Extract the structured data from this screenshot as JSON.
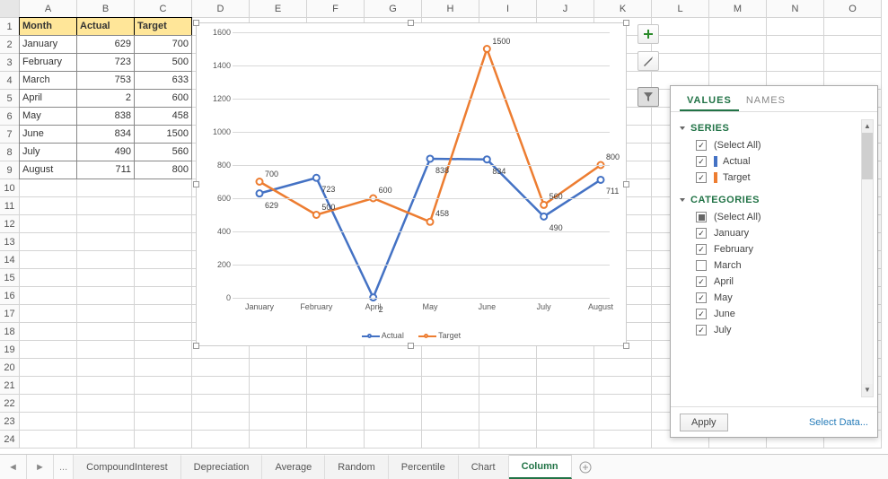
{
  "columns": [
    "A",
    "B",
    "C",
    "D",
    "E",
    "F",
    "G",
    "H",
    "I",
    "J",
    "K",
    "L",
    "M",
    "N",
    "O"
  ],
  "rows": [
    "1",
    "2",
    "3",
    "4",
    "5",
    "6",
    "7",
    "8",
    "9",
    "10",
    "11",
    "12",
    "13",
    "14",
    "15",
    "16",
    "17",
    "18",
    "19",
    "20",
    "21",
    "22",
    "23",
    "24"
  ],
  "table": {
    "headers": [
      "Month",
      "Actual",
      "Target"
    ],
    "data": [
      [
        "January",
        "629",
        "700"
      ],
      [
        "February",
        "723",
        "500"
      ],
      [
        "March",
        "753",
        "633"
      ],
      [
        "April",
        "2",
        "600"
      ],
      [
        "May",
        "838",
        "458"
      ],
      [
        "June",
        "834",
        "1500"
      ],
      [
        "July",
        "490",
        "560"
      ],
      [
        "August",
        "711",
        "800"
      ]
    ]
  },
  "chart_data": {
    "type": "line",
    "categories": [
      "January",
      "February",
      "April",
      "May",
      "June",
      "July",
      "August"
    ],
    "series": [
      {
        "name": "Actual",
        "color": "#4472C4",
        "values": [
          629,
          723,
          2,
          838,
          834,
          490,
          711
        ]
      },
      {
        "name": "Target",
        "color": "#ED7D31",
        "values": [
          700,
          500,
          600,
          458,
          1500,
          560,
          800
        ]
      }
    ],
    "ylim": [
      0,
      1600
    ],
    "ystep": 200,
    "yticks": [
      "0",
      "200",
      "400",
      "600",
      "800",
      "1000",
      "1200",
      "1400",
      "1600"
    ]
  },
  "side_buttons": {
    "plus": "plus-icon",
    "brush": "brush-icon",
    "filter": "filter-icon"
  },
  "filter_panel": {
    "tabs": {
      "values": "VALUES",
      "names": "NAMES"
    },
    "series_title": "SERIES",
    "select_all": "(Select All)",
    "series": [
      {
        "label": "Actual",
        "color": "#4472C4"
      },
      {
        "label": "Target",
        "color": "#ED7D31"
      }
    ],
    "categories_title": "CATEGORIES",
    "cat_items": [
      {
        "label": "(Select All)",
        "state": "indet"
      },
      {
        "label": "January",
        "state": "checked"
      },
      {
        "label": "February",
        "state": "checked"
      },
      {
        "label": "March",
        "state": "unchecked"
      },
      {
        "label": "April",
        "state": "checked"
      },
      {
        "label": "May",
        "state": "checked"
      },
      {
        "label": "June",
        "state": "checked"
      },
      {
        "label": "July",
        "state": "checked"
      }
    ],
    "apply": "Apply",
    "select_data": "Select Data..."
  },
  "sheet_tabs": [
    "CompoundInterest",
    "Depreciation",
    "Average",
    "Random",
    "Percentile",
    "Chart",
    "Column"
  ],
  "active_sheet": "Column",
  "sheet_ellipsis": "..."
}
